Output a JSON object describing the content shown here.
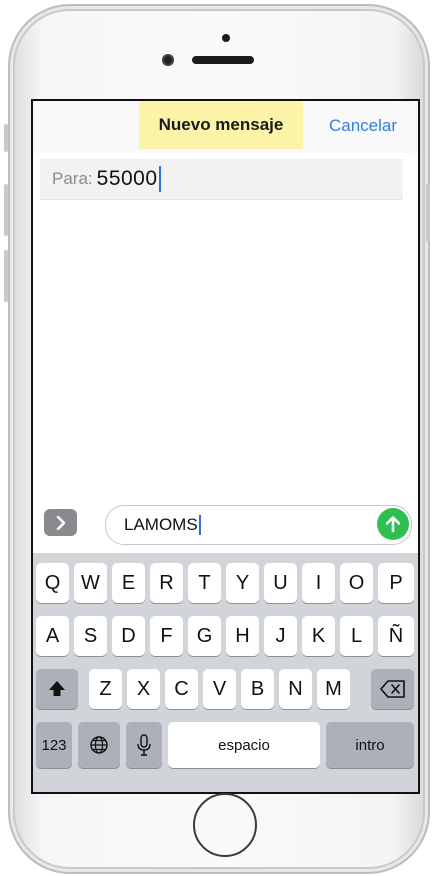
{
  "header": {
    "title": "Nuevo mensaje",
    "cancel_label": "Cancelar"
  },
  "recipient": {
    "label": "Para:",
    "value": "55000"
  },
  "compose": {
    "expand_icon": "chevron-right-icon",
    "message_text": "LAMOMS",
    "send_icon": "arrow-up-icon",
    "send_color": "#2fbf4f"
  },
  "keyboard": {
    "row1": [
      "Q",
      "W",
      "E",
      "R",
      "T",
      "Y",
      "U",
      "I",
      "O",
      "P"
    ],
    "row2": [
      "A",
      "S",
      "D",
      "F",
      "G",
      "H",
      "J",
      "K",
      "L",
      "Ñ"
    ],
    "row3": [
      "Z",
      "X",
      "C",
      "V",
      "B",
      "N",
      "M"
    ],
    "shift_icon": "shift-arrow-icon",
    "backspace_icon": "backspace-icon",
    "numbers_label": "123",
    "globe_icon": "globe-icon",
    "mic_icon": "microphone-icon",
    "space_label": "espacio",
    "return_label": "intro"
  },
  "colors": {
    "accent": "#2f7fe0",
    "title_highlight": "#fbf3a8",
    "keyboard_bg": "#d1d4d9"
  }
}
